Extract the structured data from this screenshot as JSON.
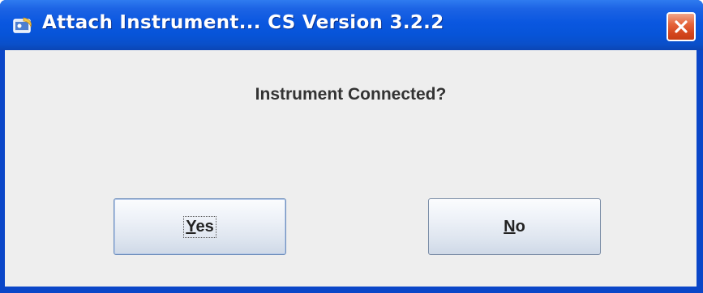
{
  "window": {
    "title": "Attach Instrument... CS Version 3.2.2",
    "title_icon": "java-app-icon",
    "close_icon": "close-icon"
  },
  "dialog": {
    "message": "Instrument Connected?",
    "buttons": {
      "yes": {
        "mnemonic": "Y",
        "rest": "es"
      },
      "no": {
        "mnemonic": "N",
        "rest": "o"
      }
    }
  },
  "colors": {
    "titlebar": "#0a57e0",
    "close_button": "#d4461e",
    "client_background": "#eeeeee"
  }
}
